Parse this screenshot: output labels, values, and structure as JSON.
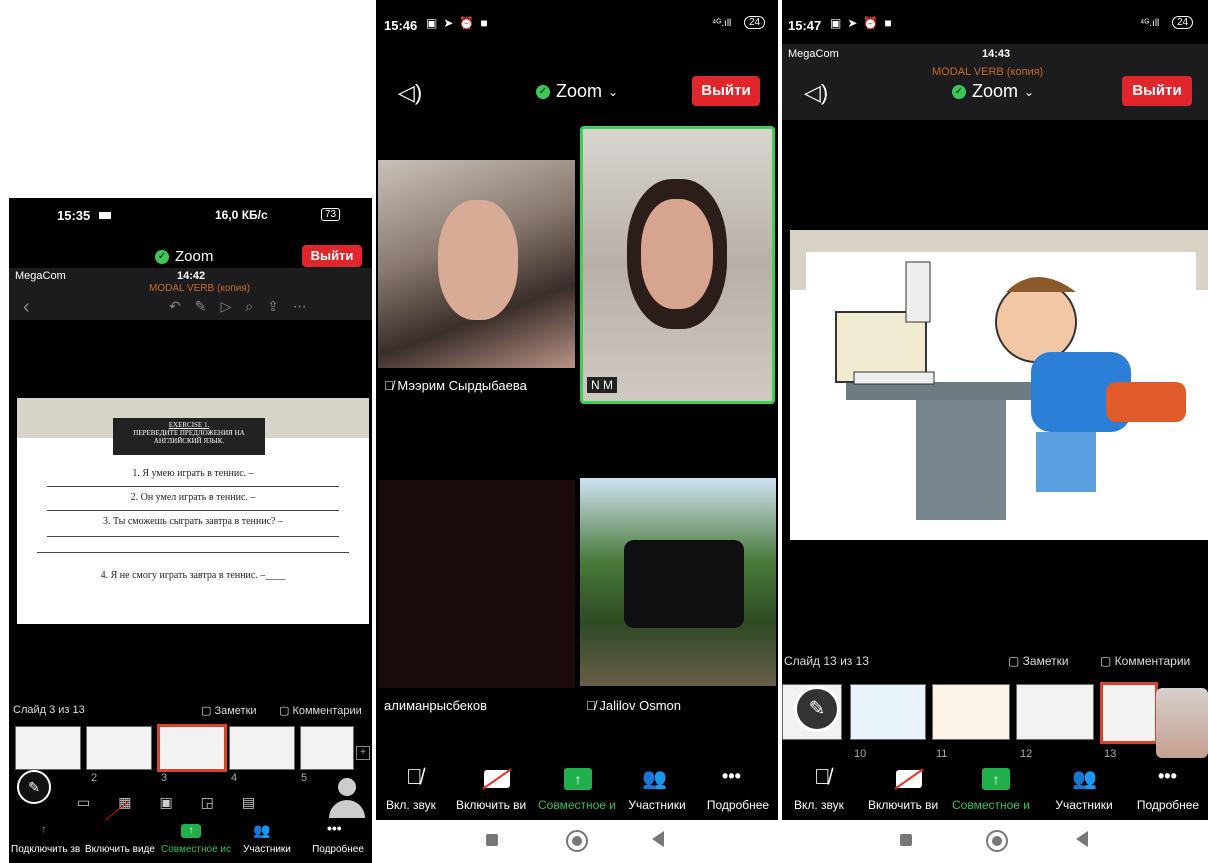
{
  "p1": {
    "status_time": "15:35",
    "status_right": "16,0 КБ/с",
    "battery": "73",
    "zoom_title": "Zoom",
    "leave": "Выйти",
    "ios_carrier": "MegaCom",
    "ios_time": "14:42",
    "doc_title": "MODAL VERB (копия)",
    "slide": {
      "exercise": "EXERCISE 1.",
      "heading": "ПЕРЕВЕДИТЕ ПРЕДЛОЖЕНИЯ НА АНГЛИЙСКИЙ ЯЗЫК.",
      "line1": "1. Я умею играть в теннис. –",
      "line2": "2. Он умел играть в теннис. –",
      "line3": "3. Ты сможешь сыграть завтра в теннис? –",
      "line4": "4. Я не смогу играть завтра в теннис. –____"
    },
    "slide_counter": "Слайд 3 из 13",
    "notes": "Заметки",
    "comments": "Комментарии",
    "thumb_nums": [
      "2",
      "3",
      "4",
      "5"
    ],
    "toolbar": [
      "Подключить зв",
      "Включить виде",
      "Совместное ис",
      "Участники",
      "Подробнее"
    ]
  },
  "p2": {
    "status_time": "15:46",
    "battery": "24",
    "zoom_title": "Zoom",
    "leave": "Выйти",
    "participants": [
      "Мээрим Сырдыбаева",
      "N M",
      "алиманрысбеков",
      "Jalilov Osmon"
    ],
    "toolbar": [
      "Вкл. звук",
      "Включить ви",
      "Совместное и",
      "Участники",
      "Подробнее"
    ]
  },
  "p3": {
    "status_time": "15:47",
    "battery": "24",
    "zoom_title": "Zoom",
    "leave": "Выйти",
    "ios_carrier": "MegaCom",
    "ios_time": "14:43",
    "doc_title": "MODAL VERB (копия)",
    "slide_counter": "Слайд 13 из 13",
    "notes": "Заметки",
    "comments": "Комментарии",
    "thumb_nums": [
      "10",
      "11",
      "12",
      "13"
    ],
    "toolbar": [
      "Вкл. звук",
      "Включить ви",
      "Совместное и",
      "Участники",
      "Подробнее"
    ]
  },
  "colors": {
    "leave_red": "#e0262b",
    "zoom_green": "#2fc35a",
    "active_border": "#3bd05a",
    "slide_selected": "#d9422b"
  }
}
